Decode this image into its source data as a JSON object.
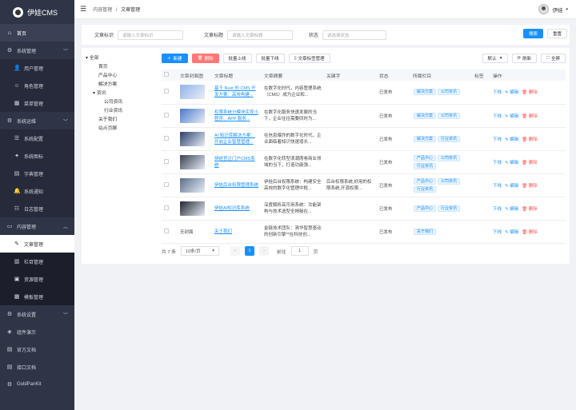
{
  "app": {
    "title": "伊娃CMS"
  },
  "sidebar": {
    "items": [
      {
        "label": "首页",
        "icon": "home-icon",
        "glyph": "⌂"
      },
      {
        "label": "系统管理",
        "icon": "gear-icon",
        "glyph": "⚙"
      },
      {
        "label": "用户管理",
        "icon": "user-icon",
        "glyph": "👤"
      },
      {
        "label": "角色管理",
        "icon": "people-icon",
        "glyph": "☺"
      },
      {
        "label": "菜单管理",
        "icon": "grid-icon",
        "glyph": "▦"
      },
      {
        "label": "系统运维",
        "icon": "monitor-icon",
        "glyph": "⚙"
      },
      {
        "label": "系统配置",
        "icon": "sliders-icon",
        "glyph": "☰"
      },
      {
        "label": "系统图标",
        "icon": "star-icon",
        "glyph": "✦"
      },
      {
        "label": "字典管理",
        "icon": "book-icon",
        "glyph": "▤"
      },
      {
        "label": "系统通知",
        "icon": "bell-icon",
        "glyph": "🔔"
      },
      {
        "label": "日志管理",
        "icon": "log-icon",
        "glyph": "☷"
      },
      {
        "label": "内容管理",
        "icon": "content-icon",
        "glyph": "▭"
      },
      {
        "label": "文章管理",
        "icon": "article-icon",
        "glyph": "✎"
      },
      {
        "label": "栏目管理",
        "icon": "column-icon",
        "glyph": "▥"
      },
      {
        "label": "资源管理",
        "icon": "resource-icon",
        "glyph": "▣"
      },
      {
        "label": "模板管理",
        "icon": "template-icon",
        "glyph": "▦"
      },
      {
        "label": "系统设置",
        "icon": "settings-icon",
        "glyph": "⚙"
      },
      {
        "label": "组件演示",
        "icon": "component-icon",
        "glyph": "◈"
      },
      {
        "label": "官方文档",
        "icon": "doc-icon",
        "glyph": "▤"
      },
      {
        "label": "接口文档",
        "icon": "api-doc-icon",
        "glyph": "▤"
      },
      {
        "label": "GoldPanKit",
        "icon": "kit-icon",
        "glyph": "⚙"
      }
    ]
  },
  "header": {
    "breadcrumb_parent": "内容管理",
    "breadcrumb_sep": "/",
    "breadcrumb_current": "文章管理",
    "username": "伊娃"
  },
  "filter": {
    "id_label": "文章标识",
    "id_placeholder": "请输入文章标识",
    "title_label": "文章标题",
    "title_placeholder": "请输入文章标题",
    "status_label": "状态",
    "status_placeholder": "请选择状态",
    "search_btn": "搜索",
    "reset_btn": "重置"
  },
  "tree": {
    "root": "全部",
    "nodes": [
      "首页",
      "产品中心",
      "解决方案",
      "资讯",
      "公司资讯",
      "行业资讯",
      "关于我们",
      "站点页脚"
    ]
  },
  "toolbar": {
    "new": "新建",
    "delete": "删除",
    "batch_online": "批量上线",
    "batch_offline": "批量下线",
    "tag_manage": "文章标签管理",
    "sort_default": "默认",
    "refresh": "刷新",
    "fullscreen": "全屏"
  },
  "table": {
    "headers": [
      "文章封面图",
      "文章标题",
      "文章摘要",
      "关键字",
      "状态",
      "所属栏目",
      "标签",
      "操作"
    ],
    "rows": [
      {
        "cover": "img",
        "cover_color": "#8fb3e8",
        "title": "基于 Nuxt 的 CMS 开发方案：高效构建...",
        "summary": "在数字化时代，内容管理系统（CMS）成为企业和...",
        "keywords": "",
        "status": "已发布",
        "tags": [
          "解决方案",
          "公司资讯"
        ]
      },
      {
        "cover": "img",
        "cover_color": "#4a78c8",
        "title": "权限系统分模块实现小程序、APP 服务...",
        "summary": "在数字化服务快速发展的当下，企业往往需要同时为...",
        "keywords": "",
        "status": "已发布",
        "tags": [
          "解决方案",
          "公司资讯"
        ]
      },
      {
        "cover": "img",
        "cover_color": "#2b3f6b",
        "title": "AI 知识库解决方案：开启企业智慧管理...",
        "summary": "在信息爆炸的数字化时代，企业面临着知识快速增长...",
        "keywords": "",
        "status": "已发布",
        "tags": [
          "解决方案",
          "行业资讯"
        ]
      },
      {
        "cover": "img",
        "cover_color": "#3a4150",
        "title": "伊娃官企门户CMS系统",
        "summary": "在数字化转型浪潮席卷商业领域的当下，打造功能强...",
        "keywords": "",
        "status": "已发布",
        "tags": [
          "产品中心",
          "公司资讯",
          "行业资讯"
        ]
      },
      {
        "cover": "img",
        "cover_color": "#5b6d8a",
        "title": "伊娃后台权限管理系统",
        "summary": "伊娃后台权限系统：构建安全高效的数字化管理中枢...",
        "keywords": "后台权限系统,好用的权限系统,开源权限...",
        "status": "已发布",
        "tags": [
          "产品中心",
          "公司资讯",
          "行业资讯"
        ]
      },
      {
        "cover": "img",
        "cover_color": "#1f2430",
        "title": "伊娃AI知识库系统",
        "summary": "深度解析高可用系统：功能架构与技术选型全揭秘在...",
        "keywords": "",
        "status": "已发布",
        "tags": [
          "产品中心",
          "行业资讯"
        ]
      },
      {
        "cover": "text",
        "cover_color": "",
        "cover_text": "无封面",
        "title": "关于我们",
        "summary": "金链技术团队：清华智慧驱动的创新引擎**在科技创...",
        "keywords": "",
        "status": "已发布",
        "tags": [
          "关于我们"
        ]
      }
    ],
    "ops": {
      "offline": "下线",
      "edit": "编辑",
      "delete": "删除"
    }
  },
  "pager": {
    "total": "共 7 条",
    "page_size": "10条/页",
    "prev": "‹",
    "current": "1",
    "next": "›",
    "goto_label": "前往",
    "goto_value": "1",
    "page_unit": "页"
  },
  "colors": {
    "primary": "#1890ff",
    "danger": "#ff4d4f",
    "sidebar": "#2f3447"
  }
}
